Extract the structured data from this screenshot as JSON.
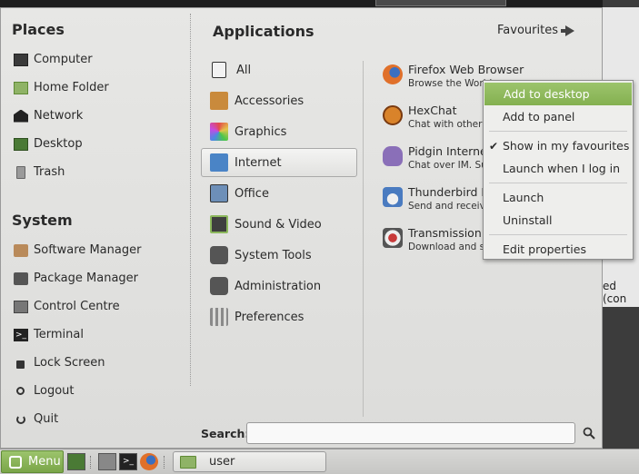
{
  "places": {
    "title": "Places",
    "items": [
      {
        "label": "Computer",
        "icon": "computer-icon"
      },
      {
        "label": "Home Folder",
        "icon": "home-folder-icon"
      },
      {
        "label": "Network",
        "icon": "network-icon"
      },
      {
        "label": "Desktop",
        "icon": "desktop-icon"
      },
      {
        "label": "Trash",
        "icon": "trash-icon"
      }
    ]
  },
  "system": {
    "title": "System",
    "items": [
      {
        "label": "Software Manager",
        "icon": "software-manager-icon"
      },
      {
        "label": "Package Manager",
        "icon": "package-manager-icon"
      },
      {
        "label": "Control Centre",
        "icon": "control-centre-icon"
      },
      {
        "label": "Terminal",
        "icon": "terminal-icon"
      },
      {
        "label": "Lock Screen",
        "icon": "lock-icon"
      },
      {
        "label": "Logout",
        "icon": "logout-icon"
      },
      {
        "label": "Quit",
        "icon": "power-icon"
      }
    ]
  },
  "applications": {
    "title": "Applications",
    "favourites_label": "Favourites",
    "categories": [
      {
        "label": "All",
        "icon": "all-icon",
        "color": "#f2f2f2"
      },
      {
        "label": "Accessories",
        "icon": "accessories-icon",
        "color": "#c98a3c"
      },
      {
        "label": "Graphics",
        "icon": "graphics-icon",
        "color": "#d84fa2"
      },
      {
        "label": "Internet",
        "icon": "internet-icon",
        "color": "#4a84c6"
      },
      {
        "label": "Office",
        "icon": "office-icon",
        "color": "#6d8fb8"
      },
      {
        "label": "Sound & Video",
        "icon": "sound-video-icon",
        "color": "#3f3f3f"
      },
      {
        "label": "System Tools",
        "icon": "system-tools-icon",
        "color": "#555555"
      },
      {
        "label": "Administration",
        "icon": "administration-icon",
        "color": "#555555"
      },
      {
        "label": "Preferences",
        "icon": "preferences-icon",
        "color": "#8a8a8a"
      }
    ],
    "selected_category": "Internet",
    "apps": [
      {
        "name": "Firefox Web Browser",
        "desc": "Browse the World",
        "icon": "firefox-icon",
        "color": "#e0702a"
      },
      {
        "name": "HexChat",
        "desc": "Chat with other p",
        "icon": "hexchat-icon",
        "color": "#d9832a"
      },
      {
        "name": "Pidgin Internet M",
        "desc": "Chat over IM. Sup",
        "icon": "pidgin-icon",
        "color": "#8a6fb8"
      },
      {
        "name": "Thunderbird M",
        "desc": "Send and receive",
        "icon": "thunderbird-icon",
        "color": "#4a7bc0"
      },
      {
        "name": "Transmission",
        "desc": "Download and sh",
        "icon": "transmission-icon",
        "color": "#c83a3a"
      }
    ]
  },
  "search": {
    "label": "Search:",
    "value": ""
  },
  "context_menu": {
    "items": [
      {
        "label": "Add to desktop",
        "highlighted": true
      },
      {
        "label": "Add to panel"
      },
      {
        "label": "Show in my favourites",
        "checked": true
      },
      {
        "label": "Launch when I log in"
      },
      {
        "label": "Launch"
      },
      {
        "label": "Uninstall"
      },
      {
        "label": "Edit properties"
      }
    ]
  },
  "taskbar": {
    "menu_label": "Menu",
    "window_label": "user"
  },
  "background": {
    "partial_text": "ed (con"
  },
  "colors": {
    "accent": "#8cb85c",
    "menu_bg": "#e3e3e1",
    "text": "#2a2a2a"
  }
}
